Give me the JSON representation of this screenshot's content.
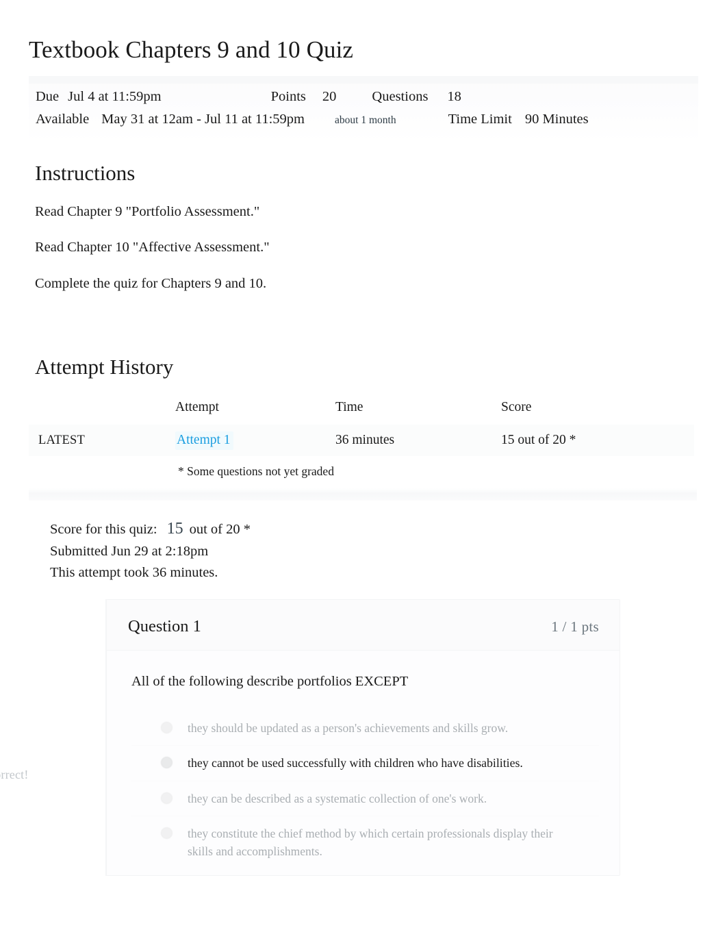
{
  "quiz": {
    "title": "Textbook Chapters 9 and 10 Quiz",
    "meta": {
      "due_label": "Due",
      "due_value": "Jul 4 at 11:59pm",
      "points_label": "Points",
      "points_value": "20",
      "questions_label": "Questions",
      "questions_value": "18",
      "available_label": "Available",
      "available_value": "May 31 at 12am - Jul 11 at 11:59pm",
      "available_relative": "about 1 month",
      "time_limit_label": "Time Limit",
      "time_limit_value": "90 Minutes"
    }
  },
  "instructions": {
    "heading": "Instructions",
    "paragraphs": [
      "Read Chapter 9 \"Portfolio Assessment.\"",
      "Read Chapter 10 \"Affective Assessment.\"",
      "Complete the quiz for Chapters 9 and 10."
    ]
  },
  "attempt_history": {
    "heading": "Attempt History",
    "columns": [
      "Attempt",
      "Time",
      "Score"
    ],
    "rows": [
      {
        "kept": "LATEST",
        "attempt": "Attempt 1",
        "time": "36 minutes",
        "score": "15 out of 20 *"
      }
    ],
    "footnote": "* Some questions not yet graded"
  },
  "score_summary": {
    "label": "Score for this quiz:",
    "score": "15",
    "out_of": "out of 20 *",
    "submitted": "Submitted Jun 29 at 2:18pm",
    "duration": "This attempt took 36 minutes."
  },
  "questions": [
    {
      "name": "Question 1",
      "points": "1 / 1 pts",
      "result_flag": "Correct!",
      "text": "All of the following describe portfolios   EXCEPT",
      "answers": [
        {
          "text": "they should be updated as a person's achievements and skills grow.",
          "selected": false
        },
        {
          "text": "they cannot be used successfully with children who have disabilities.",
          "selected": true
        },
        {
          "text": "they can be described as a systematic collection of one's work.",
          "selected": false
        },
        {
          "text": "they constitute the chief method by which certain professionals display their skills and accomplishments.",
          "selected": false
        }
      ]
    }
  ],
  "colors": {
    "link": "#1a9ee0",
    "text": "#1a1a1a",
    "muted": "#a9aeb2",
    "panel": "#fbfbfc"
  }
}
